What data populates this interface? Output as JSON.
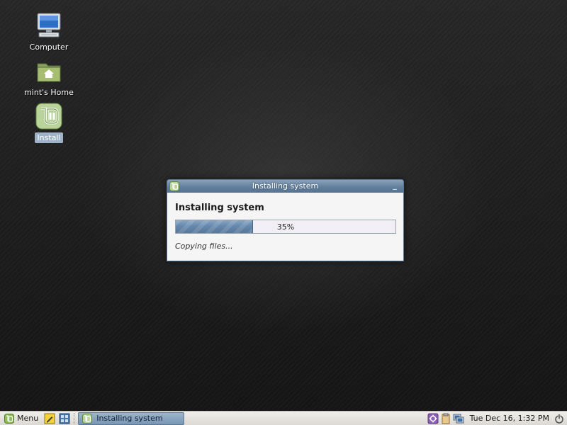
{
  "desktop": {
    "icons": [
      {
        "label": "Computer",
        "icon": "computer-icon"
      },
      {
        "label": "mint's Home",
        "icon": "home-folder-icon"
      },
      {
        "label": "Install",
        "icon": "mint-install-icon",
        "selected": true
      }
    ]
  },
  "window": {
    "title": "Installing system",
    "minimize_glyph": "_",
    "heading": "Installing system",
    "progress_percent": 35,
    "progress_text": "35%",
    "status": "Copying files..."
  },
  "panel": {
    "menu_label": "Menu",
    "task_label": "Installing system",
    "clock": "Tue Dec 16,  1:32 PM"
  },
  "colors": {
    "mint_green": "#8fbd5a",
    "titlebar": "#62809e",
    "progress_fill": "#6688ac"
  }
}
